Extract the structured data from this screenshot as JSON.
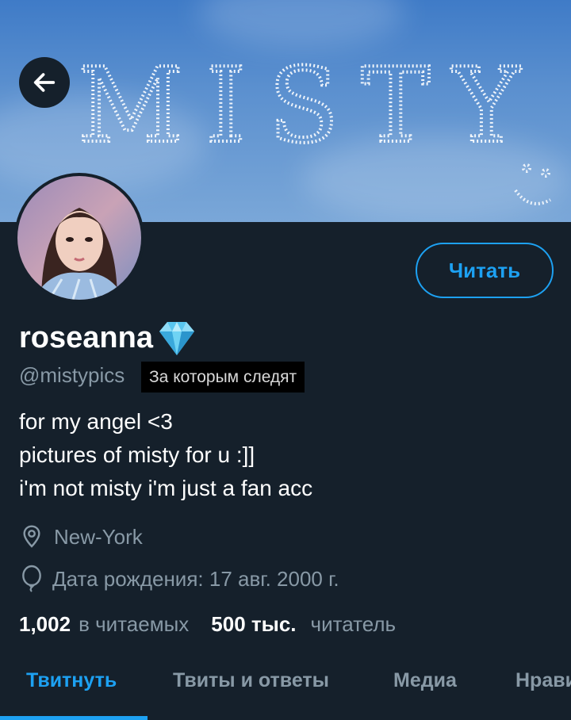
{
  "banner": {
    "text": "MISTY"
  },
  "profile": {
    "name": "roseanna",
    "handle": "@mistypics",
    "follows_you": "За которым следят",
    "follow_button": "Читать",
    "bio": [
      "for my angel <3",
      "pictures of misty for u :]]",
      "i'm not misty i'm just a fan acc"
    ],
    "location": "New-York",
    "birthday": "Дата рождения: 17 авг. 2000 г."
  },
  "stats": {
    "following_count": "1,002",
    "following_label": "в читаемых",
    "followers_count": "500 тыс.",
    "followers_label": "читатель"
  },
  "tabs": [
    "Твитнуть",
    "Твиты и ответы",
    "Медиа",
    "Нравится"
  ],
  "colors": {
    "background": "#15202b",
    "accent": "#1da1f2",
    "muted": "#8899a6"
  }
}
